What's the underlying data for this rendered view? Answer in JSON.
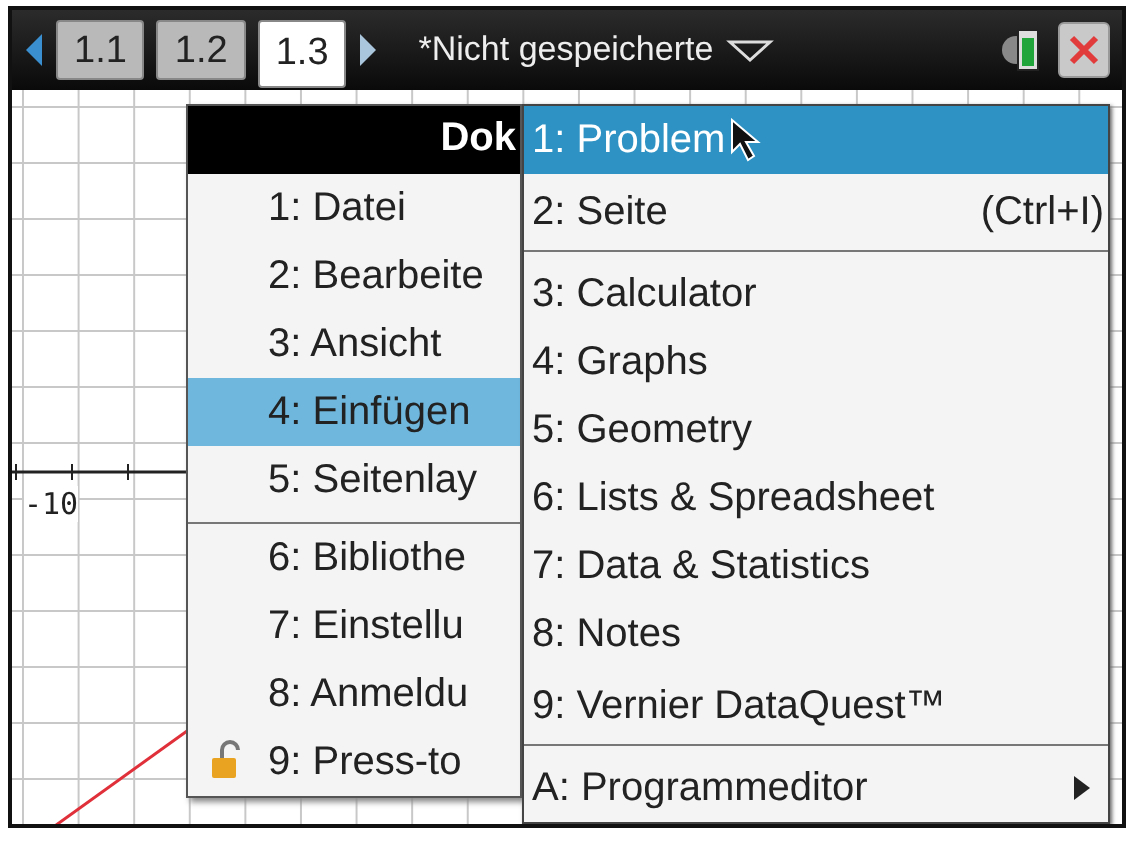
{
  "tabs": [
    {
      "label": "1.1",
      "selected": false
    },
    {
      "label": "1.2",
      "selected": false
    },
    {
      "label": "1.3",
      "selected": true
    }
  ],
  "document_title": "*Nicht gespeicherte",
  "graph": {
    "axis_label": "-10"
  },
  "menu": {
    "title": "Dok",
    "items": [
      {
        "label": "1: Datei",
        "selected": false,
        "divider_after": false,
        "lock": false
      },
      {
        "label": "2: Bearbeite",
        "selected": false,
        "divider_after": false,
        "lock": false
      },
      {
        "label": "3: Ansicht",
        "selected": false,
        "divider_after": false,
        "lock": false
      },
      {
        "label": "4: Einfügen",
        "selected": true,
        "divider_after": false,
        "lock": false
      },
      {
        "label": "5: Seitenlay",
        "selected": false,
        "divider_after": true,
        "lock": false
      },
      {
        "label": "6: Bibliothe",
        "selected": false,
        "divider_after": false,
        "lock": false
      },
      {
        "label": "7: Einstellu",
        "selected": false,
        "divider_after": false,
        "lock": false
      },
      {
        "label": "8: Anmeldu",
        "selected": false,
        "divider_after": false,
        "lock": false
      },
      {
        "label": "9: Press-to",
        "selected": false,
        "divider_after": false,
        "lock": true
      }
    ]
  },
  "submenu": {
    "items": [
      {
        "label": "1: Problem",
        "selected": true,
        "divider_after": false,
        "has_submenu": false
      },
      {
        "label": "2: Seite",
        "shortcut": "(Ctrl+I)",
        "selected": false,
        "divider_after": true,
        "has_submenu": false
      },
      {
        "label": "3: Calculator",
        "selected": false,
        "divider_after": false,
        "has_submenu": false
      },
      {
        "label": "4: Graphs",
        "selected": false,
        "divider_after": false,
        "has_submenu": false
      },
      {
        "label": "5: Geometry",
        "selected": false,
        "divider_after": false,
        "has_submenu": false
      },
      {
        "label": "6: Lists & Spreadsheet",
        "selected": false,
        "divider_after": false,
        "has_submenu": false
      },
      {
        "label": "7: Data & Statistics",
        "selected": false,
        "divider_after": false,
        "has_submenu": false
      },
      {
        "label": "8: Notes",
        "selected": false,
        "divider_after": false,
        "has_submenu": false
      },
      {
        "label": "9: Vernier DataQuest™",
        "selected": false,
        "divider_after": true,
        "has_submenu": false
      },
      {
        "label": "A: Programmeditor",
        "selected": false,
        "divider_after": false,
        "has_submenu": true
      }
    ]
  }
}
